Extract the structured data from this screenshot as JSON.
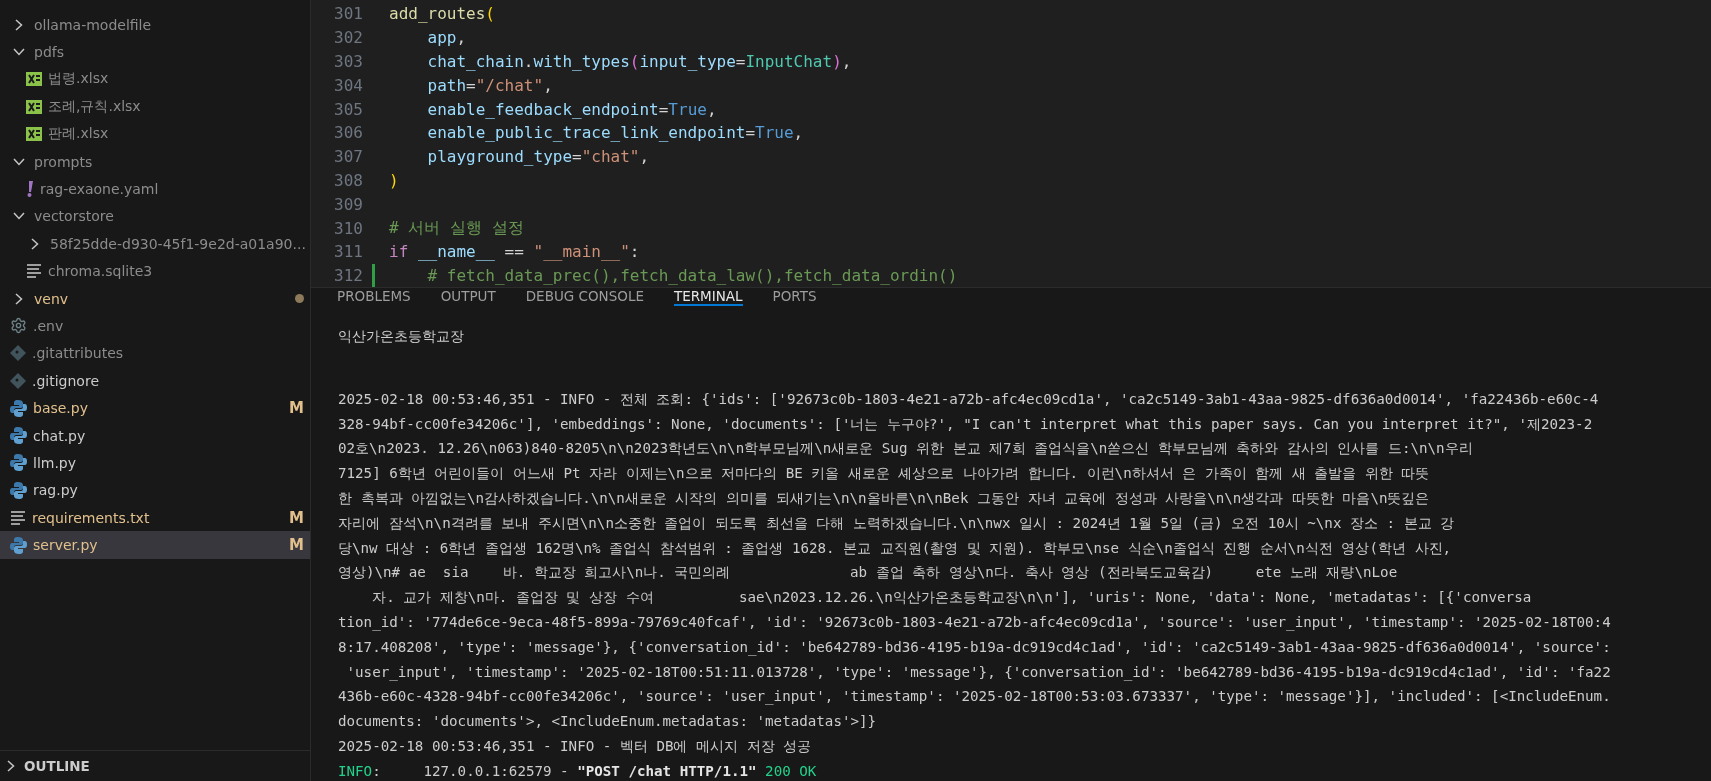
{
  "explorer": {
    "items": [
      {
        "label": "ollama-modelfile",
        "kind": "folder",
        "expanded": false,
        "modified": false,
        "ignored": true,
        "selected": false
      },
      {
        "label": "pdfs",
        "kind": "folder",
        "expanded": true,
        "modified": false,
        "ignored": true,
        "selected": false,
        "children": [
          {
            "label": "법령.xlsx",
            "kind": "excel",
            "modified": false,
            "ignored": true,
            "selected": false
          },
          {
            "label": "조례,규칙.xlsx",
            "kind": "excel",
            "modified": false,
            "ignored": true,
            "selected": false
          },
          {
            "label": "판례.xlsx",
            "kind": "excel",
            "modified": false,
            "ignored": true,
            "selected": false
          }
        ]
      },
      {
        "label": "prompts",
        "kind": "folder",
        "expanded": true,
        "modified": false,
        "ignored": true,
        "selected": false,
        "children": [
          {
            "label": "rag-exaone.yaml",
            "kind": "yaml",
            "modified": false,
            "ignored": true,
            "selected": false
          }
        ]
      },
      {
        "label": "vectorstore",
        "kind": "folder",
        "expanded": true,
        "modified": false,
        "ignored": true,
        "selected": false,
        "children": [
          {
            "label": "58f25dde-d930-45f1-9e2d-a01a90...",
            "kind": "folder",
            "expanded": false,
            "modified": false,
            "ignored": true,
            "selected": false
          },
          {
            "label": "chroma.sqlite3",
            "kind": "text",
            "modified": false,
            "ignored": true,
            "selected": false
          }
        ]
      },
      {
        "label": "venv",
        "kind": "folder",
        "expanded": false,
        "modified": true,
        "dot": true,
        "selected": false
      },
      {
        "label": ".env",
        "kind": "gear",
        "modified": false,
        "ignored": true,
        "selected": false
      },
      {
        "label": ".gitattributes",
        "kind": "git",
        "modified": false,
        "ignored": true,
        "selected": false
      },
      {
        "label": ".gitignore",
        "kind": "git",
        "modified": false,
        "ignored": false,
        "selected": false
      },
      {
        "label": "base.py",
        "kind": "python",
        "modified": true,
        "badge": "M",
        "selected": false
      },
      {
        "label": "chat.py",
        "kind": "python",
        "modified": false,
        "ignored": false,
        "selected": false
      },
      {
        "label": "llm.py",
        "kind": "python",
        "modified": false,
        "ignored": false,
        "selected": false
      },
      {
        "label": "rag.py",
        "kind": "python",
        "modified": false,
        "ignored": false,
        "selected": false
      },
      {
        "label": "requirements.txt",
        "kind": "text",
        "modified": true,
        "badge": "M",
        "selected": false
      },
      {
        "label": "server.py",
        "kind": "python",
        "modified": true,
        "badge": "M",
        "selected": true
      }
    ]
  },
  "outline": {
    "title": "OUTLINE",
    "expanded": false
  },
  "code": [
    {
      "number": "301",
      "modified": false,
      "tokens": [
        {
          "text": "add_routes",
          "kind": "func"
        },
        {
          "text": "(",
          "kind": "paren"
        }
      ]
    },
    {
      "number": "302",
      "modified": false,
      "tokens": [
        {
          "text": "    app",
          "kind": "var"
        },
        {
          "text": ",",
          "kind": "op"
        }
      ]
    },
    {
      "number": "303",
      "modified": false,
      "tokens": [
        {
          "text": "    chat_chain",
          "kind": "var"
        },
        {
          "text": ".",
          "kind": "op"
        },
        {
          "text": "with_types",
          "kind": "var"
        },
        {
          "text": "(",
          "kind": "paren2"
        },
        {
          "text": "input_type",
          "kind": "var"
        },
        {
          "text": "=",
          "kind": "op"
        },
        {
          "text": "InputChat",
          "kind": "class"
        },
        {
          "text": ")",
          "kind": "paren2"
        },
        {
          "text": ",",
          "kind": "op"
        }
      ]
    },
    {
      "number": "304",
      "modified": false,
      "tokens": [
        {
          "text": "    path",
          "kind": "var"
        },
        {
          "text": "=",
          "kind": "op"
        },
        {
          "text": "\"/chat\"",
          "kind": "string"
        },
        {
          "text": ",",
          "kind": "op"
        }
      ]
    },
    {
      "number": "305",
      "modified": false,
      "tokens": [
        {
          "text": "    enable_feedback_endpoint",
          "kind": "var"
        },
        {
          "text": "=",
          "kind": "op"
        },
        {
          "text": "True",
          "kind": "bool"
        },
        {
          "text": ",",
          "kind": "op"
        }
      ]
    },
    {
      "number": "306",
      "modified": false,
      "tokens": [
        {
          "text": "    enable_public_trace_link_endpoint",
          "kind": "var"
        },
        {
          "text": "=",
          "kind": "op"
        },
        {
          "text": "True",
          "kind": "bool"
        },
        {
          "text": ",",
          "kind": "op"
        }
      ]
    },
    {
      "number": "307",
      "modified": false,
      "tokens": [
        {
          "text": "    playground_type",
          "kind": "var"
        },
        {
          "text": "=",
          "kind": "op"
        },
        {
          "text": "\"chat\"",
          "kind": "string"
        },
        {
          "text": ",",
          "kind": "op"
        }
      ]
    },
    {
      "number": "308",
      "modified": false,
      "tokens": [
        {
          "text": ")",
          "kind": "paren"
        }
      ]
    },
    {
      "number": "309",
      "modified": false
    },
    {
      "number": "310",
      "modified": false,
      "tokens": [
        {
          "text": "# 서버 실행 설정",
          "kind": "comment"
        }
      ]
    },
    {
      "number": "311",
      "modified": false,
      "tokens": [
        {
          "text": "if",
          "kind": "keyword"
        },
        {
          "text": " __name__ ",
          "kind": "var"
        },
        {
          "text": "== ",
          "kind": "op"
        },
        {
          "text": "\"__main__\"",
          "kind": "string"
        },
        {
          "text": ":",
          "kind": "op"
        }
      ]
    },
    {
      "number": "312",
      "modified": true,
      "tokens": [
        {
          "text": "    # fetch_data_prec(),fetch_data_law(),fetch_data_ordin()",
          "kind": "comment"
        }
      ]
    }
  ],
  "panel_tabs": [
    {
      "label": "PROBLEMS",
      "selected": false
    },
    {
      "label": "OUTPUT",
      "selected": false
    },
    {
      "label": "DEBUG CONSOLE",
      "selected": false
    },
    {
      "label": "TERMINAL",
      "selected": true
    },
    {
      "label": "PORTS",
      "selected": false
    }
  ],
  "terminal": {
    "lines": [
      {
        "kind": "text",
        "segments": [
          {
            "text": "익산가온초등학교장",
            "kind": "plain"
          }
        ]
      },
      {
        "kind": "log",
        "segments": [
          {
            "text": "2025-02-18 00:53:46,351 - INFO - 전체 조회: {'ids': ['92673c0b-1803-4e21-a72b-afc4ec09cd1a', 'ca2c5149-3ab1-43aa-9825-df636a0d0014', 'fa22436b-e60c-4",
            "kind": "plain"
          }
        ]
      },
      {
        "kind": "log",
        "segments": [
          {
            "text": "328-94bf-cc00fe34206c'], 'embeddings': None, 'documents': ['너는 누구야?', \"I can't interpret what this paper says. Can you interpret it?\", '제2023-2",
            "kind": "plain"
          }
        ]
      },
      {
        "kind": "log",
        "segments": [
          {
            "text": "02호\\n2023. 12.26\\n063)840-8205\\n\\n2023학년도\\n\\n학부모님께\\n새로운 Sug 위한 본교 제7희 졸업식을\\n쏟으신 학부모님께 축하와 감사의 인사를 드:\\n\\n우리",
            "kind": "plain"
          }
        ]
      },
      {
        "kind": "log",
        "segments": [
          {
            "text": "7125] 6학년 어린이들이 어느새 Pt 자라 이제는\\n으로 저마다의 BE 키올 새로운 셰상으로 나아가려 합니다. 이런\\n하셔서 은 가족이 함께 새 출발을 위한 따뜻",
            "kind": "plain"
          }
        ]
      },
      {
        "kind": "log",
        "segments": [
          {
            "text": "한 촉복과 아낌없는\\n감사하겠습니다.\\n\\n새로운 시작의 의미를 되새기는\\n\\n올바른\\n\\nBek 그동안 자녀 교육에 정성과 사랑을\\n\\n생각과 따뜻한 마음\\n뜻깊은",
            "kind": "plain"
          }
        ]
      },
      {
        "kind": "log",
        "segments": [
          {
            "text": "자리에 잠석\\n\\n격려를 보내 주시면\\n\\n소중한 졸업이 되도록 최선을 다해 노력하겠습니다.\\n\\nwx 일시 : 2024년 1월 5일 (금) 오전 10시 ~\\nx 장소 : 본교 강",
            "kind": "plain"
          }
        ]
      },
      {
        "kind": "log",
        "segments": [
          {
            "text": "당\\nw 대상 : 6학년 졸업생 162명\\n% 졸업식 참석범위 : 졸업생 1628. 본교 교직원(촬영 및 지원). 학부모\\nse 식순\\n졸업식 진행 순서\\n식전 영상(학년 사진,",
            "kind": "plain"
          }
        ]
      },
      {
        "kind": "log",
        "segments": [
          {
            "text": "영상)\\n# ae  sia    바. 학교장 희고사\\n나. 국민의례              ab 졸업 축하 영상\\n다. 축사 영상 (전라북도교육감)     ete 노래 재량\\nLoe",
            "kind": "plain"
          }
        ]
      },
      {
        "kind": "log",
        "segments": [
          {
            "text": "    자. 교가 제창\\n마. 졸업장 및 상장 수여          sae\\n2023.12.26.\\n익산가온초등학교장\\n\\n'], 'uris': None, 'data': None, 'metadatas': [{'conversa",
            "kind": "plain"
          }
        ]
      },
      {
        "kind": "log",
        "segments": [
          {
            "text": "tion_id': '774de6ce-9eca-48f5-899a-79769c40fcaf', 'id': '92673c0b-1803-4e21-a72b-afc4ec09cd1a', 'source': 'user_input', 'timestamp': '2025-02-18T00:4",
            "kind": "plain"
          }
        ]
      },
      {
        "kind": "log",
        "segments": [
          {
            "text": "8:17.408208', 'type': 'message'}, {'conversation_id': 'be642789-bd36-4195-b19a-dc919cd4c1ad', 'id': 'ca2c5149-3ab1-43aa-9825-df636a0d0014', 'source':",
            "kind": "plain"
          }
        ]
      },
      {
        "kind": "log",
        "segments": [
          {
            "text": " 'user_input', 'timestamp': '2025-02-18T00:51:11.013728', 'type': 'message'}, {'conversation_id': 'be642789-bd36-4195-b19a-dc919cd4c1ad', 'id': 'fa22",
            "kind": "plain"
          }
        ]
      },
      {
        "kind": "log",
        "segments": [
          {
            "text": "436b-e60c-4328-94bf-cc00fe34206c', 'source': 'user_input', 'timestamp': '2025-02-18T00:53:03.673337', 'type': 'message'}], 'included': [<IncludeEnum.",
            "kind": "plain"
          }
        ]
      },
      {
        "kind": "log",
        "segments": [
          {
            "text": "documents: 'documents'>, <IncludeEnum.metadatas: 'metadatas'>]}",
            "kind": "plain"
          }
        ]
      },
      {
        "kind": "log",
        "segments": [
          {
            "text": "2025-02-18 00:53:46,351 - INFO - 벡터 DB에 메시지 저장 성공",
            "kind": "plain"
          }
        ]
      },
      {
        "kind": "log",
        "segments": [
          {
            "text": "INFO",
            "kind": "green"
          },
          {
            "text": ":     127.0.0.1:62579 - ",
            "kind": "plain"
          },
          {
            "text": "\"POST /chat HTTP/1.1\"",
            "kind": "bold"
          },
          {
            "text": " 200 OK",
            "kind": "green"
          }
        ]
      }
    ]
  }
}
